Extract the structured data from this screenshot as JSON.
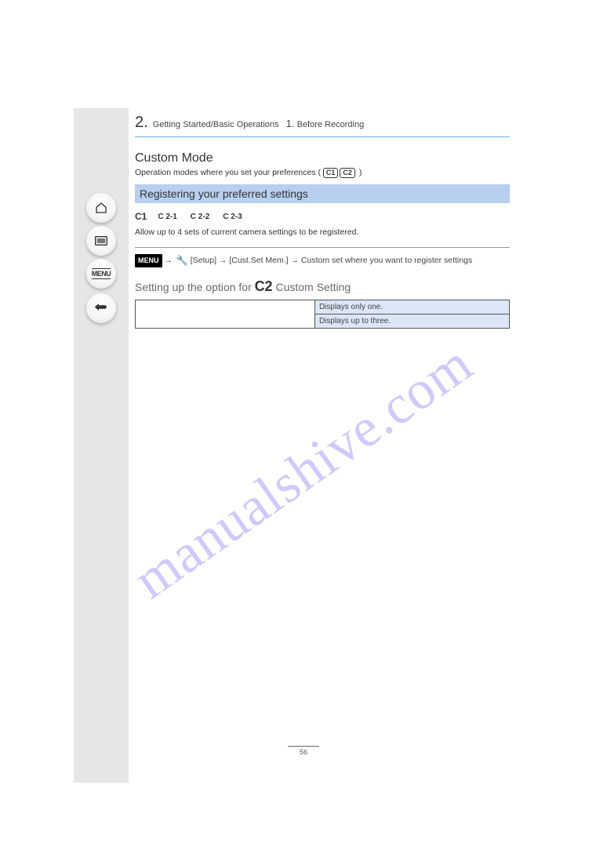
{
  "sidebar": {
    "home": "home-icon",
    "list": "list-icon",
    "menu_label": "MENU",
    "back": "back-icon"
  },
  "header": {
    "section_number": "2.",
    "section_text": "Getting Started/Basic Operations",
    "chapter_number": "1.",
    "chapter_text": "Before Recording"
  },
  "intro": {
    "title": "Custom Mode",
    "desc_prefix": "Operation modes where you set your preferences (",
    "box1": "C1",
    "box2": "C2",
    "desc_suffix": ")"
  },
  "bluehead": "Registering your preferred settings",
  "modes": {
    "c1": "C1",
    "c21": "C 2-1",
    "c22": "C 2-2",
    "c23": "C 2-3"
  },
  "reg_text": "Allow up to 4 sets of current camera settings to be registered. ",
  "menuchip": "MENU",
  "arrow": "→",
  "wrench_label": "wrench-icon",
  "path": "[Setup] → [Cust.Set Mem.] → Custom set where you want to register settings",
  "table_title_prefix": "Setting up the option for ",
  "table_title_c2": "C2",
  "table_title_suffix": " Custom Setting",
  "opt_rows": [
    {
      "l": "",
      "r1": "Displays only one.",
      "r2": "Displays up to three."
    }
  ],
  "page_number": "56",
  "watermark": "manualshive.com"
}
